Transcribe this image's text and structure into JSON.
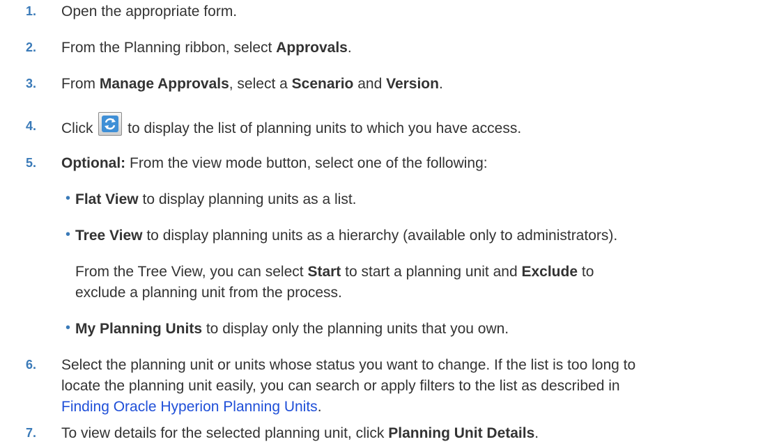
{
  "steps": [
    {
      "num": "1.",
      "text": "Open the appropriate form."
    },
    {
      "num": "2.",
      "pre": "From the Planning ribbon, select ",
      "b1": "Approvals",
      "post": "."
    },
    {
      "num": "3.",
      "pre": "From ",
      "b1": "Manage Approvals",
      "mid1": ", select a ",
      "b2": "Scenario",
      "mid2": " and ",
      "b3": "Version",
      "post": "."
    },
    {
      "num": "4.",
      "pre": "Click ",
      "post": " to display the list of planning units to which you have access."
    },
    {
      "num": "5.",
      "b1": "Optional:",
      "post": " From the view mode button, select one of the following:"
    },
    {
      "num": "6.",
      "line1": "Select the planning unit or units whose status you want to change. If the list is too long to",
      "line2": "locate the planning unit easily, you can search or apply filters to the list as described in",
      "link": "Finding Oracle Hyperion Planning Units",
      "post": "."
    },
    {
      "num": "7.",
      "pre": "To view details for the selected planning unit, click ",
      "b1": "Planning Unit Details",
      "post": "."
    }
  ],
  "bullets": [
    {
      "b": "Flat View",
      "text": " to display planning units as a list."
    },
    {
      "b": "Tree View",
      "text": " to display planning units as a hierarchy (available only to administrators)."
    },
    {
      "b": "My Planning Units",
      "text": " to display only the planning units that you own."
    }
  ],
  "tree_note": {
    "pre": "From the Tree View, you can select ",
    "b1": "Start",
    "mid": " to start a planning unit and ",
    "b2": "Exclude",
    "post1": " to",
    "line2": "exclude a planning unit from the process."
  },
  "bullet_char": "•",
  "icon": "refresh-icon",
  "colors": {
    "step_number": "#3a7ab8",
    "link": "#1f4fd8",
    "text": "#333333"
  }
}
